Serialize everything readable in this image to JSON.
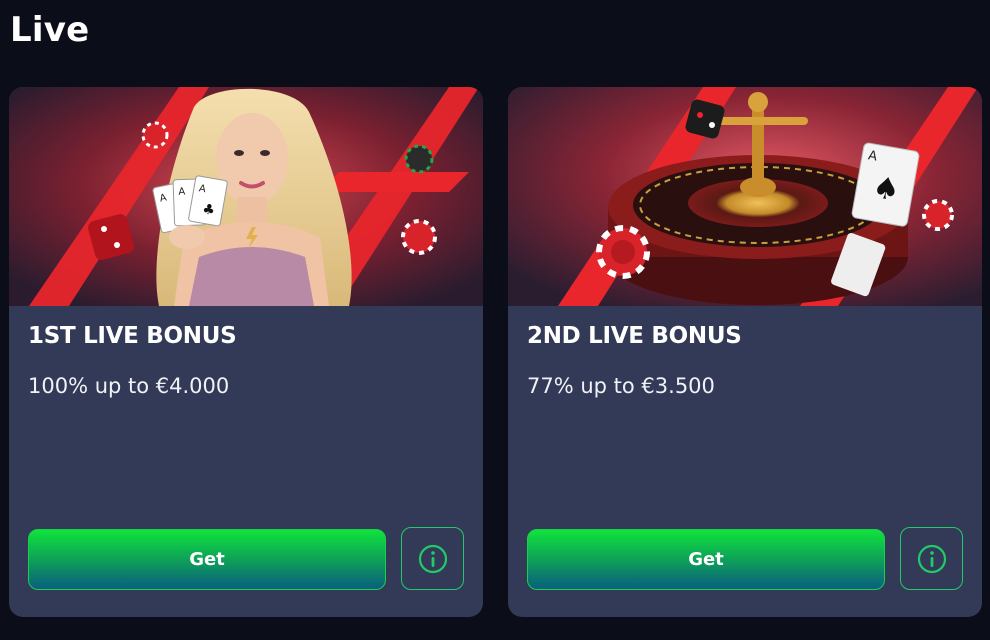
{
  "section": {
    "title": "Live"
  },
  "cards": [
    {
      "title": "1ST LIVE BONUS",
      "subtitle": "100% up to €4.000",
      "get_label": "Get",
      "info_icon": "info-icon",
      "image": "live-dealer-promo-image"
    },
    {
      "title": "2ND LIVE BONUS",
      "subtitle": "77% up to €3.500",
      "get_label": "Get",
      "info_icon": "info-icon",
      "image": "roulette-wheel-promo-image"
    }
  ],
  "colors": {
    "page_bg": "#0b0d18",
    "card_bg": "#333a57",
    "accent_green": "#10e33c",
    "accent_red": "#e8262c"
  }
}
